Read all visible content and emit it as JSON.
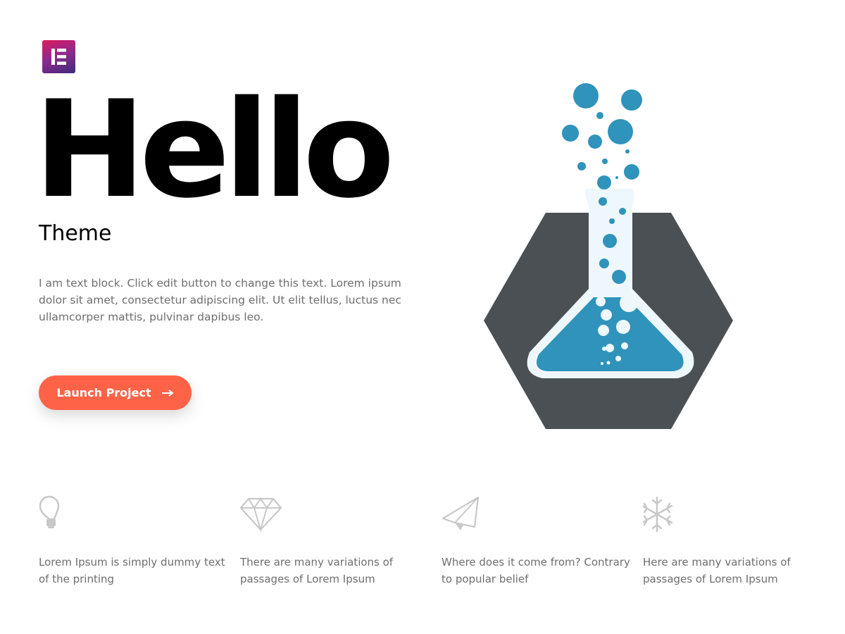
{
  "logo": {
    "icon": "elementor-logo-icon",
    "colors": [
      "#e0185e",
      "#8c2a8f",
      "#3f2a79"
    ]
  },
  "hero": {
    "title": "Hello",
    "subtitle": "Theme",
    "body": "I am text block. Click edit button to change this text. Lorem ipsum dolor sit amet, consectetur adipiscing elit. Ut elit tellus, luctus nec ullamcorper mattis, pulvinar dapibus leo.",
    "cta_label": "Launch Project",
    "cta_icon": "arrow-right-icon",
    "cta_color": "#ff6347"
  },
  "illustration": {
    "icon": "flask-hexagon-icon",
    "colors": {
      "hexagon": "#4a5053",
      "liquid": "#2f93bb",
      "glass": "#eef8fc"
    }
  },
  "features": [
    {
      "icon": "lightbulb-icon",
      "text": "Lorem Ipsum is simply dummy text of the printing"
    },
    {
      "icon": "diamond-icon",
      "text": "There are many variations of passages of Lorem Ipsum"
    },
    {
      "icon": "paper-plane-icon",
      "text": "Where does it come from? Contrary to popular belief"
    },
    {
      "icon": "snowflake-icon",
      "text": "Here are many variations of passages of Lorem Ipsum"
    }
  ],
  "icon_color": "#c8c8c8"
}
